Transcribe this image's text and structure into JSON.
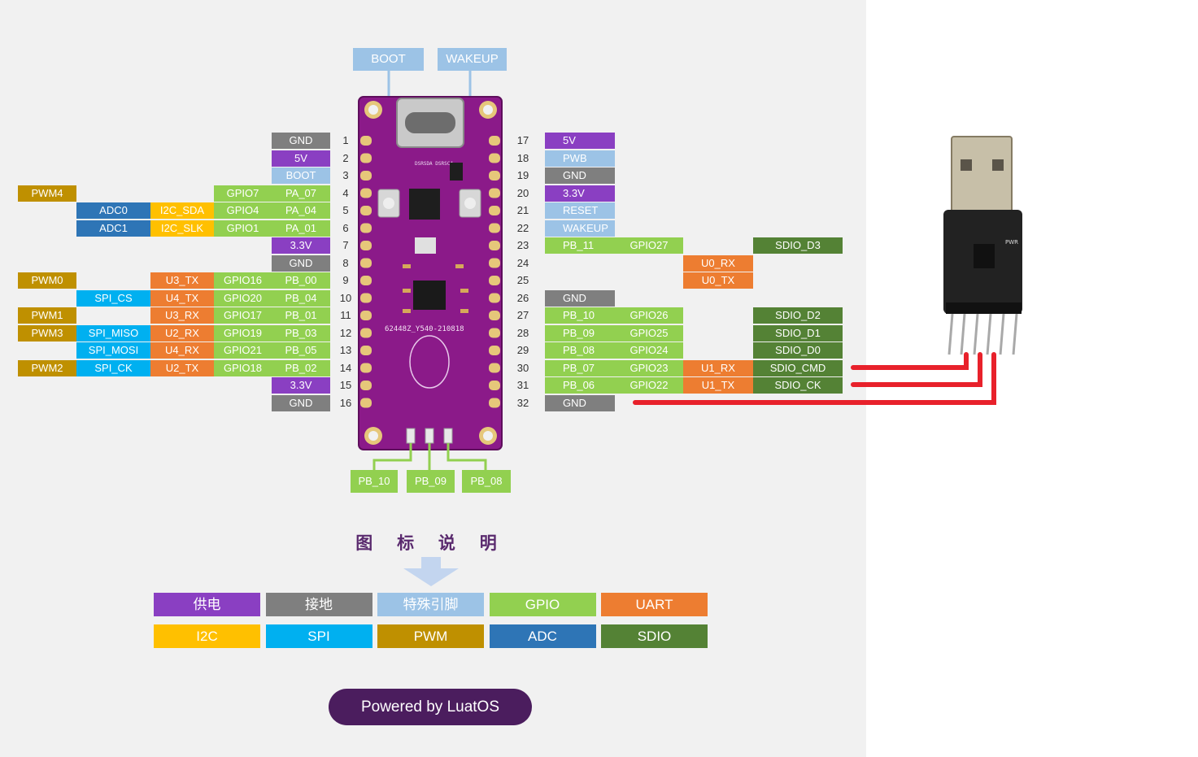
{
  "colors": {
    "power": "#8a3fc2",
    "gnd": "#7f7f7f",
    "special": "#9cc3e6",
    "gpio": "#92d050",
    "uart": "#ed7d31",
    "i2c": "#ffc000",
    "spi": "#00b0f0",
    "pwm": "#bf9000",
    "adc": "#2e75b6",
    "sdio": "#548235",
    "pcb": "#8b1a89",
    "wire": "#e8212b"
  },
  "top_labels": {
    "boot": "BOOT",
    "wakeup": "WAKEUP"
  },
  "bottom_labels": [
    "PB_10",
    "PB_09",
    "PB_08"
  ],
  "left_pins": [
    {
      "num": "1",
      "cols": {
        "pin": "GND"
      },
      "pin_type": "gnd"
    },
    {
      "num": "2",
      "cols": {
        "pin": "5V"
      },
      "pin_type": "power"
    },
    {
      "num": "3",
      "cols": {
        "pin": "BOOT"
      },
      "pin_type": "special"
    },
    {
      "num": "4",
      "cols": {
        "pin": "PA_07",
        "gpio": "GPIO7",
        "pwm": "PWM4"
      },
      "pin_type": "gpio"
    },
    {
      "num": "5",
      "cols": {
        "pin": "PA_04",
        "gpio": "GPIO4",
        "i2c": "I2C_SDA",
        "adc": "ADC0"
      },
      "pin_type": "gpio"
    },
    {
      "num": "6",
      "cols": {
        "pin": "PA_01",
        "gpio": "GPIO1",
        "i2c": "I2C_SLK",
        "adc": "ADC1"
      },
      "pin_type": "gpio"
    },
    {
      "num": "7",
      "cols": {
        "pin": "3.3V"
      },
      "pin_type": "power"
    },
    {
      "num": "8",
      "cols": {
        "pin": "GND"
      },
      "pin_type": "gnd"
    },
    {
      "num": "9",
      "cols": {
        "pin": "PB_00",
        "gpio": "GPIO16",
        "uart": "U3_TX",
        "pwm": "PWM0"
      },
      "pin_type": "gpio"
    },
    {
      "num": "10",
      "cols": {
        "pin": "PB_04",
        "gpio": "GPIO20",
        "uart": "U4_TX",
        "spi": "SPI_CS"
      },
      "pin_type": "gpio"
    },
    {
      "num": "11",
      "cols": {
        "pin": "PB_01",
        "gpio": "GPIO17",
        "uart": "U3_RX",
        "pwm": "PWM1"
      },
      "pin_type": "gpio"
    },
    {
      "num": "12",
      "cols": {
        "pin": "PB_03",
        "gpio": "GPIO19",
        "uart": "U2_RX",
        "spi": "SPI_MISO",
        "pwm": "PWM3"
      },
      "pin_type": "gpio"
    },
    {
      "num": "13",
      "cols": {
        "pin": "PB_05",
        "gpio": "GPIO21",
        "uart": "U4_RX",
        "spi": "SPI_MOSI"
      },
      "pin_type": "gpio"
    },
    {
      "num": "14",
      "cols": {
        "pin": "PB_02",
        "gpio": "GPIO18",
        "uart": "U2_TX",
        "spi": "SPI_CK",
        "pwm": "PWM2"
      },
      "pin_type": "gpio"
    },
    {
      "num": "15",
      "cols": {
        "pin": "3.3V"
      },
      "pin_type": "power"
    },
    {
      "num": "16",
      "cols": {
        "pin": "GND"
      },
      "pin_type": "gnd"
    }
  ],
  "right_pins": [
    {
      "num": "17",
      "cols": {
        "pin": "5V"
      },
      "pin_type": "power"
    },
    {
      "num": "18",
      "cols": {
        "pin": "PWB"
      },
      "pin_type": "special"
    },
    {
      "num": "19",
      "cols": {
        "pin": "GND"
      },
      "pin_type": "gnd"
    },
    {
      "num": "20",
      "cols": {
        "pin": "3.3V"
      },
      "pin_type": "power"
    },
    {
      "num": "21",
      "cols": {
        "pin": "RESET"
      },
      "pin_type": "special"
    },
    {
      "num": "22",
      "cols": {
        "pin": "WAKEUP"
      },
      "pin_type": "special"
    },
    {
      "num": "23",
      "cols": {
        "pin": "PB_11",
        "gpio": "GPIO27",
        "sdio": "SDIO_D3"
      },
      "pin_type": "gpio"
    },
    {
      "num": "24",
      "cols": {
        "uart": "U0_RX"
      },
      "pin_type": "none"
    },
    {
      "num": "25",
      "cols": {
        "uart": "U0_TX"
      },
      "pin_type": "none"
    },
    {
      "num": "26",
      "cols": {
        "pin": "GND"
      },
      "pin_type": "gnd"
    },
    {
      "num": "27",
      "cols": {
        "pin": "PB_10",
        "gpio": "GPIO26",
        "sdio": "SDIO_D2"
      },
      "pin_type": "gpio"
    },
    {
      "num": "28",
      "cols": {
        "pin": "PB_09",
        "gpio": "GPIO25",
        "sdio": "SDIO_D1"
      },
      "pin_type": "gpio"
    },
    {
      "num": "29",
      "cols": {
        "pin": "PB_08",
        "gpio": "GPIO24",
        "sdio": "SDIO_D0"
      },
      "pin_type": "gpio"
    },
    {
      "num": "30",
      "cols": {
        "pin": "PB_07",
        "gpio": "GPIO23",
        "uart": "U1_RX",
        "sdio": "SDIO_CMD"
      },
      "pin_type": "gpio"
    },
    {
      "num": "31",
      "cols": {
        "pin": "PB_06",
        "gpio": "GPIO22",
        "uart": "U1_TX",
        "sdio": "SDIO_CK"
      },
      "pin_type": "gpio"
    },
    {
      "num": "32",
      "cols": {
        "pin": "GND"
      },
      "pin_type": "gnd"
    }
  ],
  "pcb": {
    "silk_ic": "DSRSDA DSRSC4",
    "silk_main": "62448Z_Y540-210818",
    "usb_module_label": "PWR"
  },
  "legend": {
    "title": "图 标 说 明",
    "items": [
      {
        "label": "供电",
        "type": "power"
      },
      {
        "label": "接地",
        "type": "gnd"
      },
      {
        "label": "特殊引脚",
        "type": "special"
      },
      {
        "label": "GPIO",
        "type": "gpio"
      },
      {
        "label": "UART",
        "type": "uart"
      },
      {
        "label": "I2C",
        "type": "i2c"
      },
      {
        "label": "SPI",
        "type": "spi"
      },
      {
        "label": "PWM",
        "type": "pwm"
      },
      {
        "label": "ADC",
        "type": "adc"
      },
      {
        "label": "SDIO",
        "type": "sdio"
      }
    ]
  },
  "footer": {
    "powered": "Powered by LuatOS"
  }
}
